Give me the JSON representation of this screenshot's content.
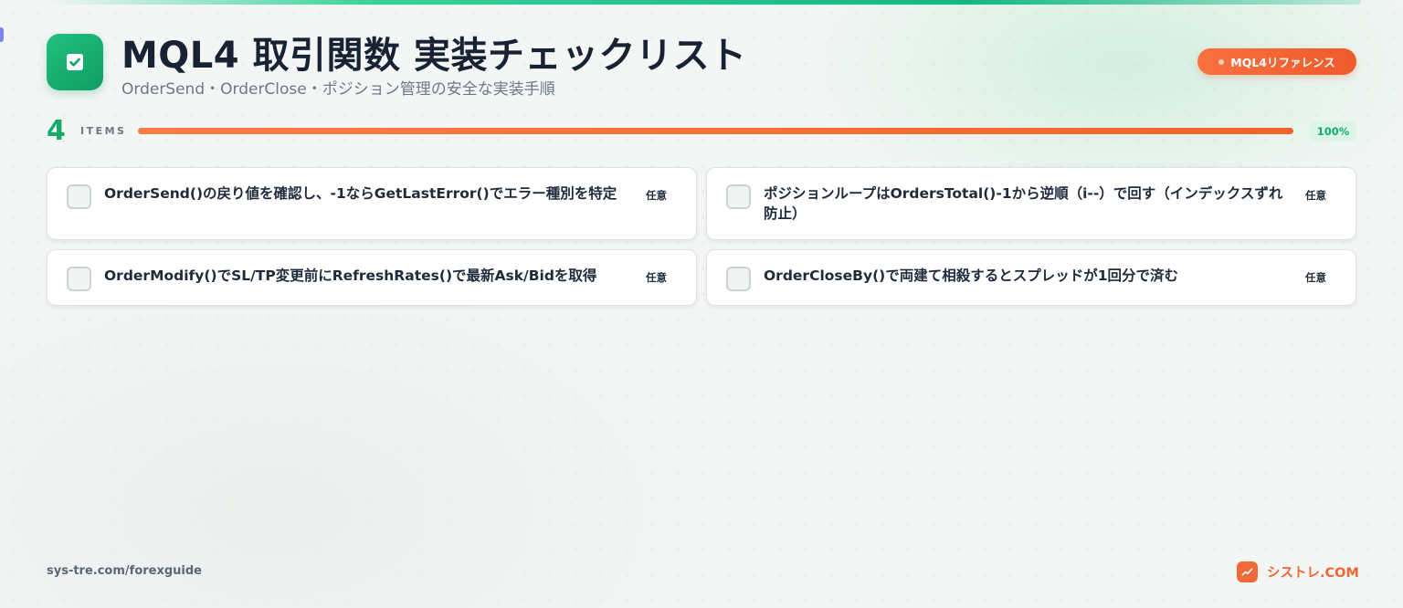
{
  "header": {
    "title": "MQL4 取引関数 実装チェックリスト",
    "subtitle": "OrderSend・OrderClose・ポジション管理の安全な実装手順",
    "reference_badge": "MQL4リファレンス",
    "logo_icon": "checkbox-check-icon"
  },
  "summary": {
    "count": "4",
    "items_label": "ITEMS",
    "progress_percent": 100,
    "progress_label": "100%"
  },
  "checklist": [
    {
      "text": "OrderSend()の戻り値を確認し、-1ならGetLastError()でエラー種別を特定",
      "tag": "任意",
      "checked": false
    },
    {
      "text": "ポジションループはOrdersTotal()-1から逆順（i--）で回す（インデックスずれ防止）",
      "tag": "任意",
      "checked": false
    },
    {
      "text": "OrderModify()でSL/TP変更前にRefreshRates()で最新Ask/Bidを取得",
      "tag": "任意",
      "checked": false
    },
    {
      "text": "OrderCloseBy()で両建て相殺するとスプレッドが1回分で済む",
      "tag": "任意",
      "checked": false
    }
  ],
  "footer": {
    "url": "sys-tre.com/forexguide",
    "brand": "シストレ.COM",
    "brand_icon": "trend-up-icon"
  },
  "colors": {
    "accent_green": "#16a96e",
    "accent_orange": "#f0632d",
    "title_text": "#172233"
  }
}
